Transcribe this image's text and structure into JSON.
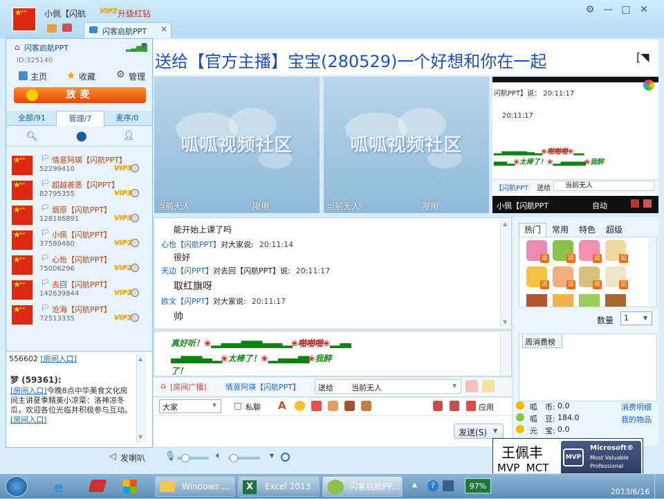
{
  "titlebar": {
    "user_name": "小佩【闪航",
    "vip_badge": "VIP2",
    "upgrade_text": "升级红钻",
    "tab_label": "闪客启航PPT",
    "tab_close": "×",
    "btn_gear": "⚙",
    "btn_min": "—",
    "btn_max": "□",
    "btn_close": "✕"
  },
  "marquee": "送给【官方主播】宝宝(280529)一个好想和你在一起",
  "room": {
    "name": "闪客启航PPT",
    "id": "ID:325140",
    "home": "主页",
    "favorite": "收藏",
    "manage": "管理",
    "fangmai": "放麦",
    "tabs": [
      "全部/91",
      "管理/7",
      "麦序/0"
    ]
  },
  "members": [
    {
      "name": "情意阿瑛【闪航PPT】",
      "id": "52299410",
      "vip": "VIP3",
      "mark": "🏳"
    },
    {
      "name": "超越善恶【闪PPT】",
      "id": "82795355",
      "vip": "VIP3",
      "mark": "🏳"
    },
    {
      "name": "烟原【闪航PPT】",
      "id": "128186891",
      "vip": "VIP3",
      "mark": "🏳"
    },
    {
      "name": "小佩【闪航PPT】",
      "id": "37589480",
      "vip": "VIP2",
      "mark": "🏳"
    },
    {
      "name": "心怡【闪航PPT】",
      "id": "75006296",
      "vip": "VIP2",
      "mark": "🏳"
    },
    {
      "name": "去回【闪航PPT】",
      "id": "142639844",
      "vip": "VIP2",
      "mark": "🏳"
    },
    {
      "name": "沧海【闪航PPT】",
      "id": "72513335",
      "vip": "VIP1",
      "mark": "🏳"
    }
  ],
  "notice": {
    "top_line_id": "556602",
    "top_line_link": "[房间入口]",
    "author": "梦 (59361):",
    "link1": "[房间入口]",
    "body": "今晚8点中华美食文化房间主讲夏季精美小凉菜：洛神凉冬瓜，欢迎各位光临并积极参与互动。",
    "link2": "[房间入口]",
    "speaker_label": "发喇叭"
  },
  "video": [
    {
      "brand": "呱呱视频社区",
      "status": "当前无人",
      "mode": "限用"
    },
    {
      "brand": "呱呱视频社区",
      "status": "当前无人",
      "mode": "限用"
    }
  ],
  "mini_chat": {
    "line1": "闪航PPT】说： 20:11:17",
    "line2": "20:11:17",
    "send_to": "送给",
    "target": "当前无人",
    "room_prefix": "【闪航PPT",
    "nick": "小佩【闪航PPT",
    "auto": "自动"
  },
  "chat": [
    {
      "type": "msg",
      "text": "能开始上课了吗"
    },
    {
      "type": "head",
      "who": "心怡【闪航PPT】",
      "mid": "对大家说:",
      "time": "20:11:14"
    },
    {
      "type": "msg",
      "text": "很好"
    },
    {
      "type": "head",
      "who": "天边【闪PPT】",
      "mid": "对去回【闪航PPT】说:",
      "time": "20:11:17"
    },
    {
      "type": "msg",
      "text": "取红旗呀"
    },
    {
      "type": "head",
      "who": "欧文【闪PPT】",
      "mid": "对大家说:",
      "time": "20:11:17"
    },
    {
      "type": "msg",
      "text": "帅"
    }
  ],
  "emo_banner": {
    "line1_start": "真好听！",
    "line1_end": "啪啪啪",
    "line2_mid": "太棒了！",
    "line2_end": "我醉",
    "line3": "了！"
  },
  "broadcast": {
    "label": "[房间广播]",
    "user": "情意阿瑛【闪航PPT】",
    "send_to": "送给",
    "target": "当前无人"
  },
  "input_bar": {
    "recipient": "大家",
    "private_label": "私聊",
    "apply_label": "应用",
    "send_label": "发送(S)"
  },
  "gifts": {
    "tabs": [
      "热门",
      "常用",
      "特色",
      "超级"
    ],
    "quantity_label": "数量",
    "quantity_value": "1",
    "weekly_tab": "周消费榜"
  },
  "wallet": {
    "coin_label": "呱　币:",
    "coin_value": "0.0",
    "bean_label": "呱　豆:",
    "bean_value": "184.0",
    "yuan_label": "元　宝:",
    "yuan_value": "0.0",
    "detail_link": "消费明细",
    "items_link": "我的物品"
  },
  "watermark": {
    "name": "王佩丰",
    "titles": "MVP  MCT",
    "mvp_line1": "Microsoft®",
    "mvp_line2": "Most Valuable",
    "mvp_line3": "Professional",
    "mvp_logo": "MVP"
  },
  "taskbar": {
    "tasks": [
      "Windows ...",
      "Excel 2013",
      "闪客启航PP..."
    ],
    "battery": "97%",
    "date": "2013/6/16"
  }
}
